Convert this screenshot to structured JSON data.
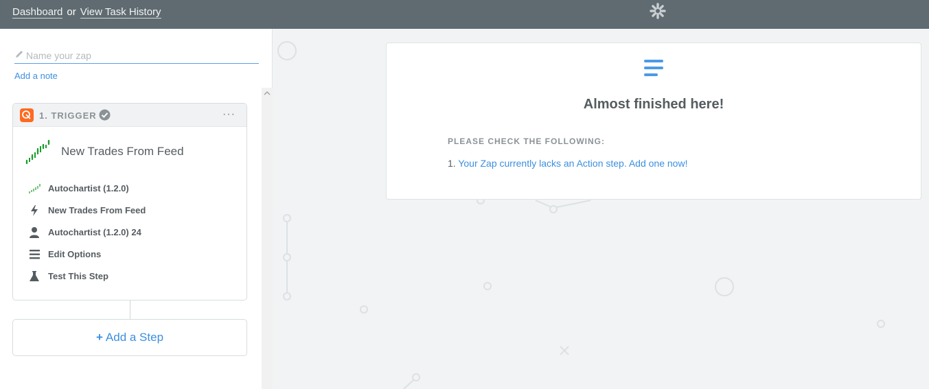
{
  "topbar": {
    "dashboard_link": "Dashboard",
    "or_text": "or",
    "task_history_link": "View Task History",
    "logo_icon": "zapier-asterisk-icon"
  },
  "editor": {
    "name_placeholder": "Name your zap",
    "add_note": "Add a note"
  },
  "trigger_card": {
    "step_label": "1. TRIGGER",
    "status_icon": "check-circle-icon",
    "menu_label": "···",
    "app_icon": "autochartist-logo-icon",
    "title": "New Trades From Feed",
    "accent_color": "#ff6a1f",
    "rows": [
      {
        "icon": "autochartist-icon",
        "label": "Autochartist (1.2.0)"
      },
      {
        "icon": "bolt-icon",
        "label": "New Trades From Feed"
      },
      {
        "icon": "user-icon",
        "label": "Autochartist (1.2.0) 24"
      },
      {
        "icon": "list-icon",
        "label": "Edit Options"
      },
      {
        "icon": "flask-icon",
        "label": "Test This Step"
      }
    ]
  },
  "add_step": {
    "plus": "+",
    "label": "Add a Step"
  },
  "status_panel": {
    "icon": "menu-lines-icon",
    "title": "Almost finished here!",
    "check_heading": "PLEASE CHECK THE FOLLOWING:",
    "items": [
      {
        "number": "1.",
        "text": "Your Zap currently lacks an Action step. Add one now!"
      }
    ]
  },
  "colors": {
    "topbar": "#5f6b70",
    "link": "#3c8fe0",
    "background": "#f1f3f4"
  }
}
